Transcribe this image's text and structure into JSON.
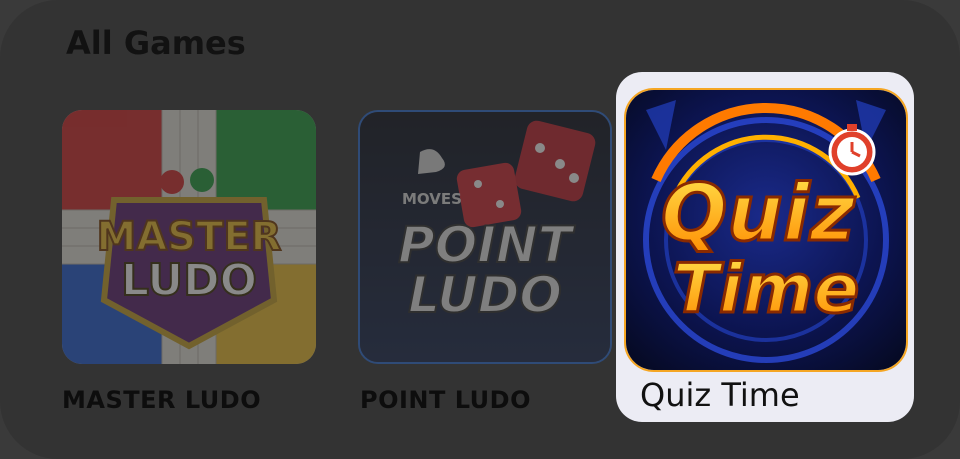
{
  "section": {
    "title": "All Games"
  },
  "games": [
    {
      "name": "MASTER LUDO",
      "art_line1": "MASTER",
      "art_line2": "LUDO",
      "selected": false
    },
    {
      "name": "POINT LUDO",
      "art_tag": "MOVES",
      "art_line1": "POINT",
      "art_line2": "LUDO",
      "selected": false
    },
    {
      "name": "Quiz Time",
      "art_line1": "Quiz",
      "art_line2": "Time",
      "selected": true
    }
  ],
  "colors": {
    "panel": "#333333",
    "highlight": "#ececf4",
    "accent": "#f5a623",
    "ludo_red": "#d62828",
    "ludo_green": "#1f9d3a",
    "ludo_blue": "#1e5bd6",
    "ludo_yellow": "#f2c12e"
  }
}
